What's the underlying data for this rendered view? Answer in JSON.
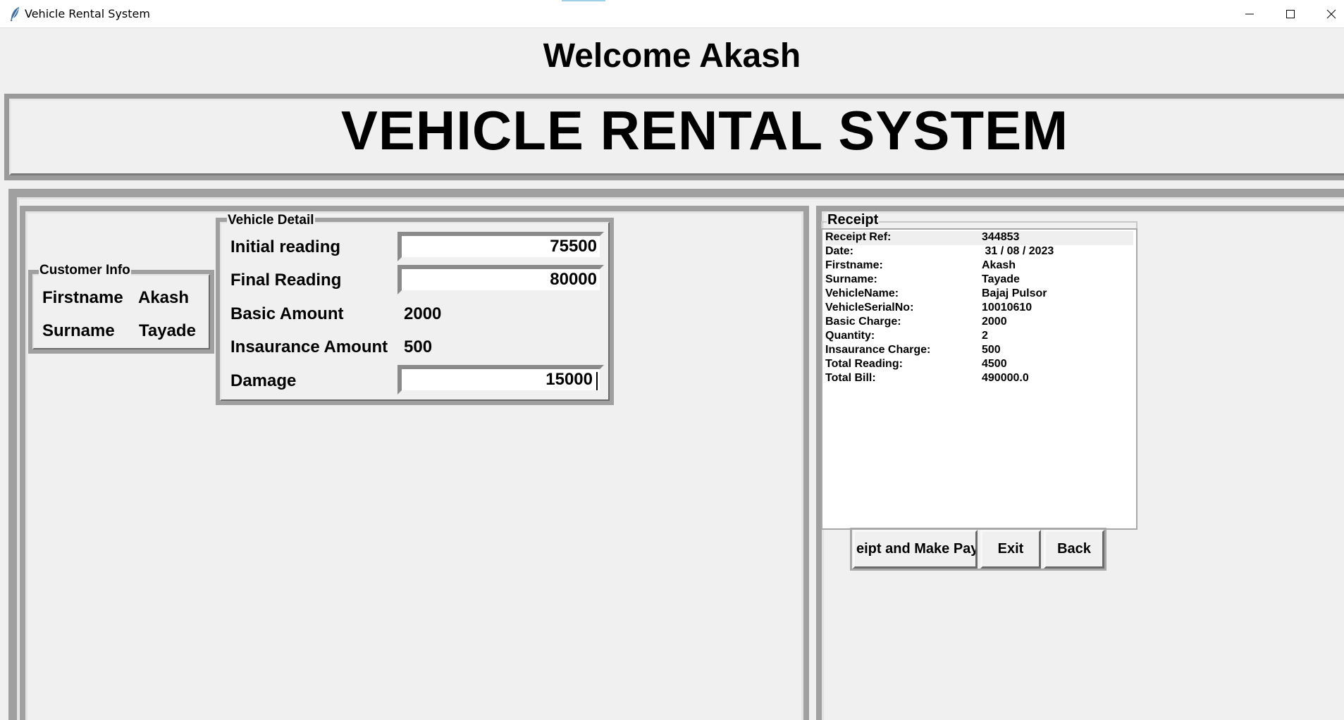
{
  "window": {
    "title": "Vehicle Rental System",
    "controls": [
      "minimize",
      "maximize",
      "close"
    ]
  },
  "welcome_text": "Welcome Akash",
  "banner_title": "VEHICLE RENTAL SYSTEM",
  "customer_info": {
    "title": "Customer Info",
    "firstname_label": "Firstname",
    "firstname_value": "Akash",
    "surname_label": "Surname",
    "surname_value": "Tayade"
  },
  "vehicle_detail": {
    "title": "Vehicle Detail",
    "initial_reading_label": "Initial reading",
    "initial_reading_value": "75500",
    "final_reading_label": "Final Reading",
    "final_reading_value": "80000",
    "basic_amount_label": "Basic Amount",
    "basic_amount_value": "2000",
    "insurance_amount_label": "Insaurance Amount",
    "insurance_amount_value": "500",
    "damage_label": "Damage",
    "damage_value": "15000"
  },
  "receipt": {
    "title": "Receipt",
    "rows": [
      {
        "key": "Receipt Ref:",
        "value": "344853"
      },
      {
        "key": "Date:",
        "value": " 31 / 08 / 2023"
      },
      {
        "key": "Firstname:",
        "value": "Akash"
      },
      {
        "key": "Surname:",
        "value": "Tayade"
      },
      {
        "key": "VehicleName:",
        "value": "Bajaj Pulsor"
      },
      {
        "key": "VehicleSerialNo:",
        "value": "10010610"
      },
      {
        "key": "Basic Charge:",
        "value": "2000"
      },
      {
        "key": "Quantity:",
        "value": "2"
      },
      {
        "key": "Insaurance Charge:",
        "value": "500"
      },
      {
        "key": "Total Reading:",
        "value": "4500"
      },
      {
        "key": "Total Bill:",
        "value": "490000.0"
      }
    ]
  },
  "buttons": {
    "receipt_payment": "eipt and Make Payr",
    "exit": "Exit",
    "back": "Back"
  }
}
